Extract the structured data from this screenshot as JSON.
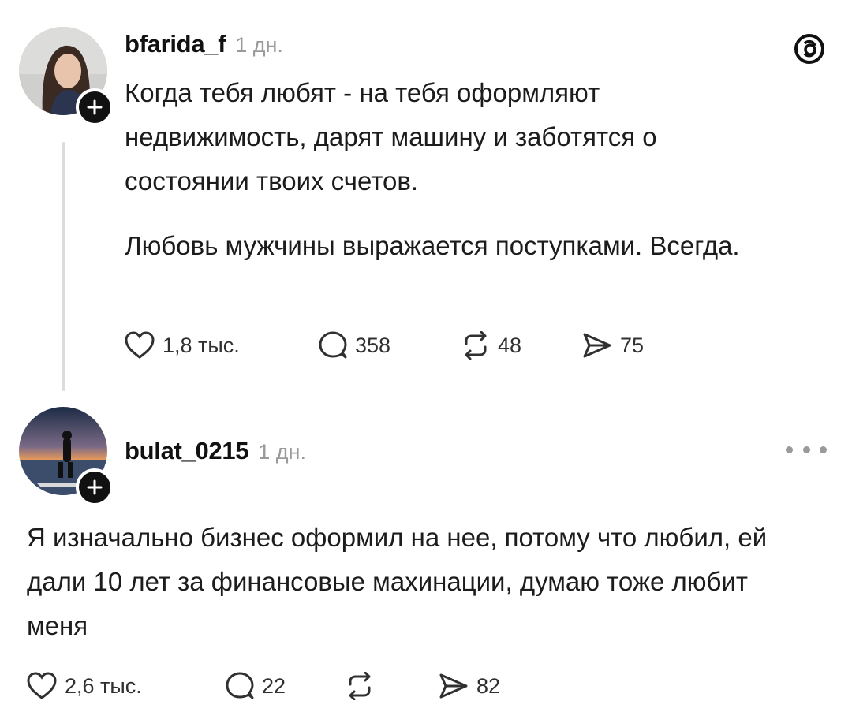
{
  "app": {
    "logo_icon": "threads-icon"
  },
  "post": {
    "username": "bfarida_f",
    "time": "1 дн.",
    "paragraphs": [
      "Когда тебя любят - на тебя оформляют недвижимость, дарят машину и заботятся о состоянии твоих счетов.",
      "Любовь мужчины выражается поступками. Всегда."
    ],
    "likes": "1,8 тыс.",
    "comments": "358",
    "reposts": "48",
    "shares": "75"
  },
  "reply": {
    "username": "bulat_0215",
    "time": "1 дн.",
    "text": "Я изначально бизнес оформил на нее, потому что любил, ей дали 10 лет за финансовые махинации, думаю тоже любит меня",
    "likes": "2,6 тыс.",
    "comments": "22",
    "reposts": "",
    "shares": "82"
  },
  "icons": [
    "heart-icon",
    "comment-icon",
    "repost-icon",
    "share-icon",
    "more-icon",
    "plus-icon"
  ]
}
